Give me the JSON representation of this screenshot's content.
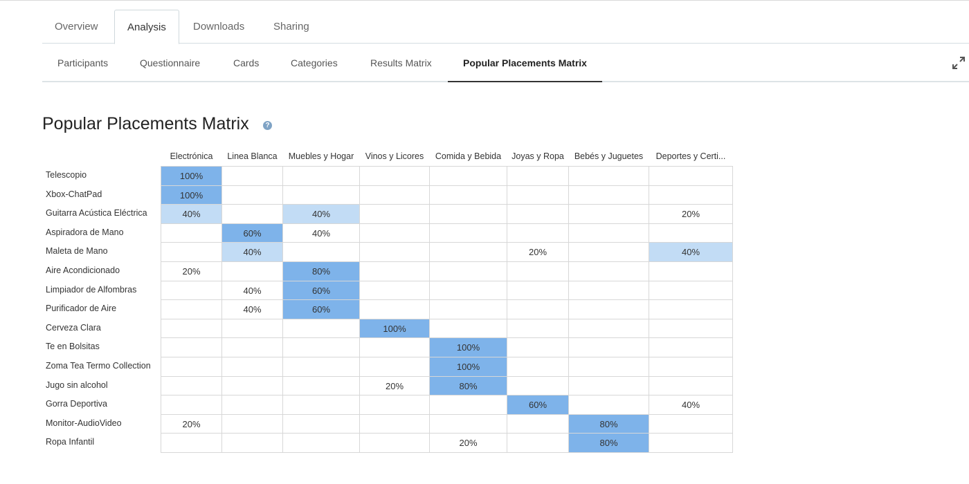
{
  "tabs": [
    {
      "label": "Overview",
      "active": false
    },
    {
      "label": "Analysis",
      "active": true
    },
    {
      "label": "Downloads",
      "active": false
    },
    {
      "label": "Sharing",
      "active": false
    }
  ],
  "subtabs": [
    {
      "label": "Participants",
      "active": false
    },
    {
      "label": "Questionnaire",
      "active": false
    },
    {
      "label": "Cards",
      "active": false
    },
    {
      "label": "Categories",
      "active": false
    },
    {
      "label": "Results Matrix",
      "active": false
    },
    {
      "label": "Popular Placements Matrix",
      "active": true
    }
  ],
  "page": {
    "title": "Popular Placements Matrix",
    "help_icon": "question-circle-icon",
    "expand_icon": "expand-arrows-icon"
  },
  "colors": {
    "high": "#7eb3ea",
    "low": "#c2dcf5"
  },
  "matrix": {
    "columns": [
      "Electrónica",
      "Linea Blanca",
      "Muebles y Hogar",
      "Vinos y Licores",
      "Comida y Bebida",
      "Joyas y Ropa",
      "Bebés y Juguetes",
      "Deportes y Certi..."
    ],
    "rows": [
      {
        "label": "Telescopio",
        "cells": [
          "100%",
          "",
          "",
          "",
          "",
          "",
          "",
          ""
        ],
        "levels": [
          "hi",
          "",
          "",
          "",
          "",
          "",
          "",
          ""
        ]
      },
      {
        "label": "Xbox-ChatPad",
        "cells": [
          "100%",
          "",
          "",
          "",
          "",
          "",
          "",
          ""
        ],
        "levels": [
          "hi",
          "",
          "",
          "",
          "",
          "",
          "",
          ""
        ]
      },
      {
        "label": "Guitarra Acústica Eléctrica",
        "cells": [
          "40%",
          "",
          "40%",
          "",
          "",
          "",
          "",
          "20%"
        ],
        "levels": [
          "lo",
          "",
          "lo",
          "",
          "",
          "",
          "",
          ""
        ]
      },
      {
        "label": "Aspiradora de Mano",
        "cells": [
          "",
          "60%",
          "40%",
          "",
          "",
          "",
          "",
          ""
        ],
        "levels": [
          "",
          "hi",
          "",
          "",
          "",
          "",
          "",
          ""
        ]
      },
      {
        "label": "Maleta de Mano",
        "cells": [
          "",
          "40%",
          "",
          "",
          "",
          "20%",
          "",
          "40%"
        ],
        "levels": [
          "",
          "lo",
          "",
          "",
          "",
          "",
          "",
          "lo"
        ]
      },
      {
        "label": "Aire Acondicionado",
        "cells": [
          "20%",
          "",
          "80%",
          "",
          "",
          "",
          "",
          ""
        ],
        "levels": [
          "",
          "",
          "hi",
          "",
          "",
          "",
          "",
          ""
        ]
      },
      {
        "label": "Limpiador de Alfombras",
        "cells": [
          "",
          "40%",
          "60%",
          "",
          "",
          "",
          "",
          ""
        ],
        "levels": [
          "",
          "",
          "hi",
          "",
          "",
          "",
          "",
          ""
        ]
      },
      {
        "label": "Purificador de Aire",
        "cells": [
          "",
          "40%",
          "60%",
          "",
          "",
          "",
          "",
          ""
        ],
        "levels": [
          "",
          "",
          "hi",
          "",
          "",
          "",
          "",
          ""
        ]
      },
      {
        "label": "Cerveza Clara",
        "cells": [
          "",
          "",
          "",
          "100%",
          "",
          "",
          "",
          ""
        ],
        "levels": [
          "",
          "",
          "",
          "hi",
          "",
          "",
          "",
          ""
        ]
      },
      {
        "label": "Te en Bolsitas",
        "cells": [
          "",
          "",
          "",
          "",
          "100%",
          "",
          "",
          ""
        ],
        "levels": [
          "",
          "",
          "",
          "",
          "hi",
          "",
          "",
          ""
        ]
      },
      {
        "label": "Zoma Tea Termo Collection",
        "cells": [
          "",
          "",
          "",
          "",
          "100%",
          "",
          "",
          ""
        ],
        "levels": [
          "",
          "",
          "",
          "",
          "hi",
          "",
          "",
          ""
        ]
      },
      {
        "label": "Jugo sin alcohol",
        "cells": [
          "",
          "",
          "",
          "20%",
          "80%",
          "",
          "",
          ""
        ],
        "levels": [
          "",
          "",
          "",
          "",
          "hi",
          "",
          "",
          ""
        ]
      },
      {
        "label": "Gorra Deportiva",
        "cells": [
          "",
          "",
          "",
          "",
          "",
          "60%",
          "",
          "40%"
        ],
        "levels": [
          "",
          "",
          "",
          "",
          "",
          "hi",
          "",
          ""
        ]
      },
      {
        "label": "Monitor-AudioVideo",
        "cells": [
          "20%",
          "",
          "",
          "",
          "",
          "",
          "80%",
          ""
        ],
        "levels": [
          "",
          "",
          "",
          "",
          "",
          "",
          "hi",
          ""
        ]
      },
      {
        "label": "Ropa Infantil",
        "cells": [
          "",
          "",
          "",
          "",
          "20%",
          "",
          "80%",
          ""
        ],
        "levels": [
          "",
          "",
          "",
          "",
          "",
          "",
          "hi",
          ""
        ]
      }
    ]
  }
}
